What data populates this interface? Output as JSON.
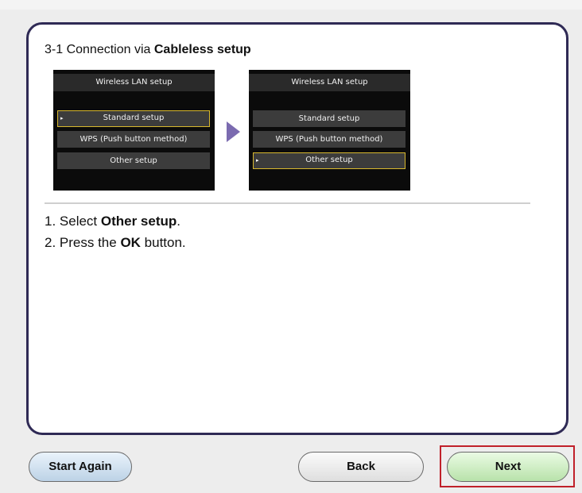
{
  "heading": {
    "prefix": "3-1 Connection via ",
    "bold": "Cableless setup"
  },
  "screen_before": {
    "title": "Wireless LAN setup",
    "items": [
      {
        "label": "Standard setup",
        "selected": true
      },
      {
        "label": "WPS (Push button method)",
        "selected": false
      },
      {
        "label": "Other setup",
        "selected": false
      }
    ]
  },
  "screen_after": {
    "title": "Wireless LAN setup",
    "items": [
      {
        "label": "Standard setup",
        "selected": false
      },
      {
        "label": "WPS (Push button method)",
        "selected": false
      },
      {
        "label": "Other setup",
        "selected": true
      }
    ]
  },
  "steps": [
    {
      "prefix": "1. Select ",
      "bold": "Other setup",
      "suffix": "."
    },
    {
      "prefix": "2. Press the ",
      "bold": "OK",
      "suffix": " button."
    }
  ],
  "buttons": {
    "start_again": "Start Again",
    "back": "Back",
    "next": "Next"
  },
  "colors": {
    "panel_border": "#2f2a55",
    "arrow": "#7b6bb0",
    "selection_outline": "#d8b82e",
    "highlight_box": "#c0202a",
    "next_button": "#b8e2aa",
    "start_button": "#bcd2e6"
  },
  "icons": {
    "transition": "arrow-right-icon",
    "selection_marker": "caret-right-icon"
  }
}
